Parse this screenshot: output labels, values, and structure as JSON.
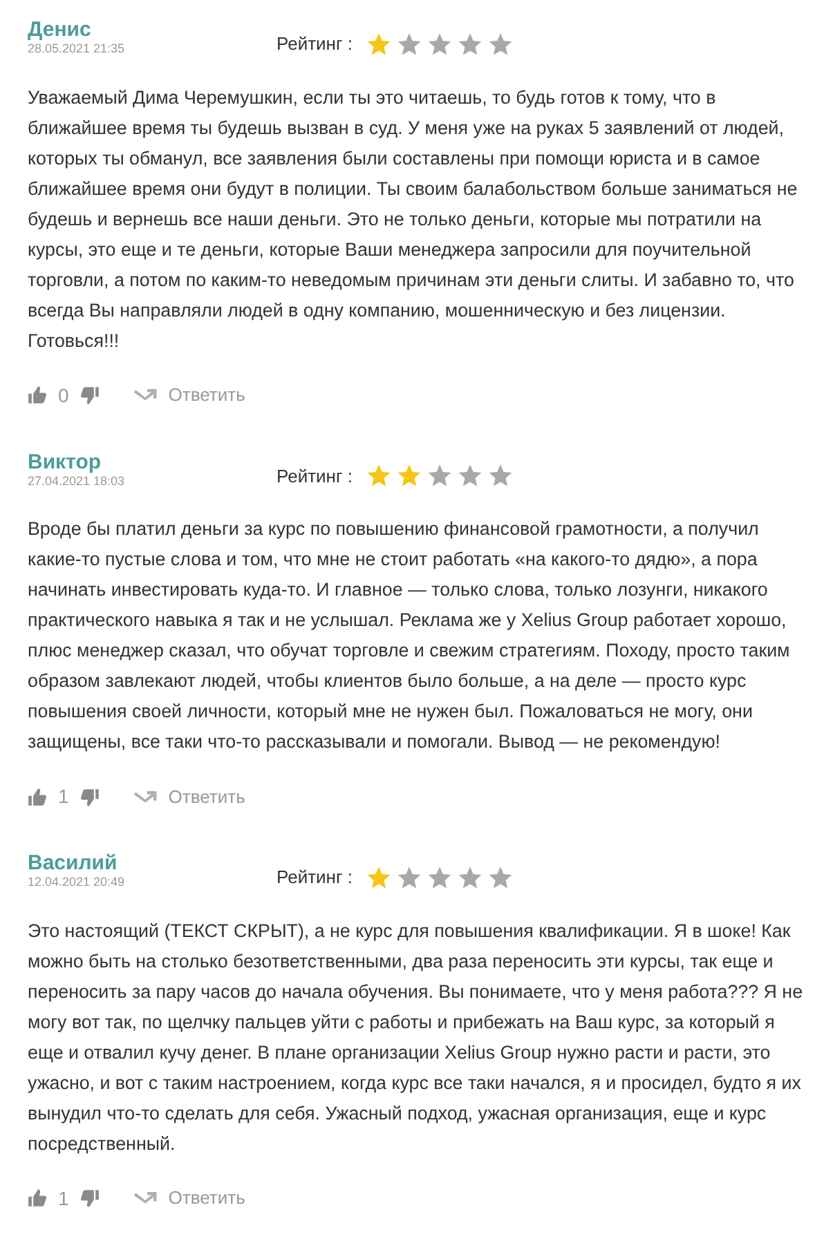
{
  "reviews": [
    {
      "author": "Денис",
      "date": "28.05.2021 21:35",
      "rating_label": "Рейтинг :",
      "stars": 1,
      "text": "Уважаемый Дима Черемушкин, если ты это читаешь, то будь готов к тому, что в ближайшее время ты будешь вызван в суд. У меня уже на руках 5 заявлений от людей, которых ты обманул, все заявления были составлены при помощи юриста и в самое ближайшее время они будут в полиции. Ты своим балабольством больше заниматься не будешь и вернешь все наши деньги. Это не только деньги, которые мы потратили на курсы, это еще и те деньги, которые Ваши менеджера запросили для поучительной торговли, а потом по каким-то неведомым причинам эти деньги слиты. И забавно то, что всегда Вы направляли людей в одну компанию, мошенническую и без лицензии. Готовься!!!",
      "likes": "0",
      "reply": "Ответить"
    },
    {
      "author": "Виктор",
      "date": "27.04.2021 18:03",
      "rating_label": "Рейтинг :",
      "stars": 2,
      "text": "Вроде бы платил деньги за курс по повышению финансовой грамотности, а получил какие-то пустые слова и том, что мне не стоит работать «на какого-то дядю», а пора начинать инвестировать куда-то. И главное — только слова, только лозунги, никакого практического навыка я так и не услышал. Реклама же у Xelius Group работает хорошо, плюс менеджер сказал, что обучат торговле и свежим стратегиям. Походу, просто таким образом завлекают людей, чтобы клиентов было больше, а на деле — просто курс повышения своей личности, который мне не нужен был. Пожаловаться не могу, они защищены, все таки что-то рассказывали и помогали. Вывод — не рекомендую!",
      "likes": "1",
      "reply": "Ответить"
    },
    {
      "author": "Василий",
      "date": "12.04.2021 20:49",
      "rating_label": "Рейтинг :",
      "stars": 1,
      "text": "Это настоящий (ТЕКСТ СКРЫТ), а не курс для повышения квалификации. Я в шоке! Как можно быть на столько безответственными, два раза переносить эти курсы, так еще и переносить за пару часов до начала обучения. Вы понимаете, что у меня работа??? Я не могу вот так, по щелчку пальцев уйти с работы и прибежать на Ваш курс, за который я еще и отвалил кучу денег. В плане организации Xelius Group нужно расти и расти, это ужасно, и вот с таким настроением, когда курс все таки начался, я и просидел, будто я их вынудил что-то сделать для себя. Ужасный подход, ужасная организация, еще и курс посредственный.",
      "likes": "1",
      "reply": "Ответить"
    }
  ]
}
